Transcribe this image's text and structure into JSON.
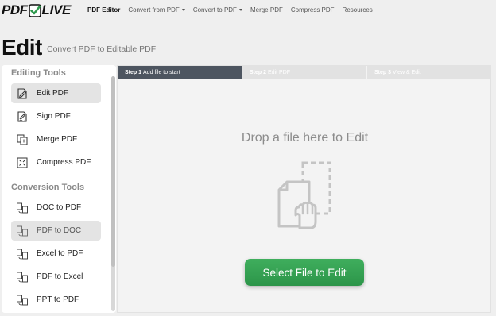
{
  "brand": {
    "pdf": "PDF",
    "live": "LIVE"
  },
  "nav": {
    "items": [
      {
        "label": "PDF Editor",
        "active": true,
        "dropdown": false
      },
      {
        "label": "Convert from PDF",
        "active": false,
        "dropdown": true
      },
      {
        "label": "Convert to PDF",
        "active": false,
        "dropdown": true
      },
      {
        "label": "Merge PDF",
        "active": false,
        "dropdown": false
      },
      {
        "label": "Compress PDF",
        "active": false,
        "dropdown": false
      },
      {
        "label": "Resources",
        "active": false,
        "dropdown": false
      }
    ]
  },
  "header": {
    "title": "Edit",
    "subtitle": "Convert PDF to Editable PDF"
  },
  "sidebar": {
    "editing_title": "Editing Tools",
    "editing_items": [
      {
        "label": "Edit PDF",
        "icon": "edit-icon",
        "selected": true
      },
      {
        "label": "Sign PDF",
        "icon": "sign-icon",
        "selected": false
      },
      {
        "label": "Merge PDF",
        "icon": "merge-icon",
        "selected": false
      },
      {
        "label": "Compress PDF",
        "icon": "compress-icon",
        "selected": false
      }
    ],
    "conversion_title": "Conversion Tools",
    "conversion_items": [
      {
        "label": "DOC to PDF",
        "icon": "convert-icon",
        "selected": false
      },
      {
        "label": "PDF to DOC",
        "icon": "convert-icon",
        "selected": true
      },
      {
        "label": "Excel to PDF",
        "icon": "convert-icon",
        "selected": false
      },
      {
        "label": "PDF to Excel",
        "icon": "convert-icon",
        "selected": false
      },
      {
        "label": "PPT to PDF",
        "icon": "convert-icon",
        "selected": false
      }
    ]
  },
  "steps": [
    {
      "num": "Step 1",
      "label": "Add file to start",
      "active": true
    },
    {
      "num": "Step 2",
      "label": "Edit PDF",
      "active": false
    },
    {
      "num": "Step 3",
      "label": "View & Edit",
      "active": false
    }
  ],
  "dropzone": {
    "title": "Drop a file here to Edit",
    "button": "Select File to Edit"
  },
  "colors": {
    "accent": "#2f9a4e",
    "step_active": "#4d5560",
    "logo_check": "#2f9a4e"
  }
}
